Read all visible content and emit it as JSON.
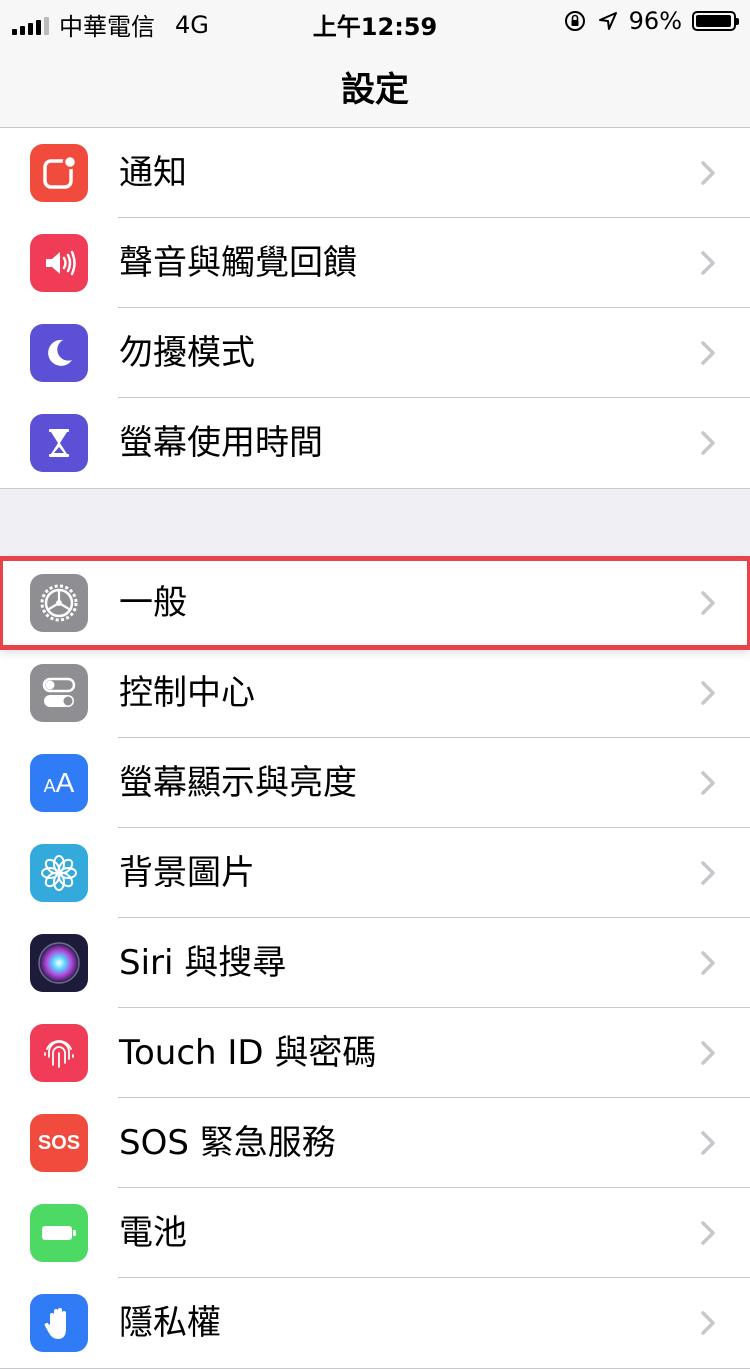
{
  "status_bar": {
    "carrier": "中華電信",
    "network": "4G",
    "time": "上午12:59",
    "battery_percent": "96%",
    "battery_level": 0.96
  },
  "nav": {
    "title": "設定"
  },
  "groups": [
    {
      "items": [
        {
          "label": "通知",
          "icon": "notifications-icon",
          "color": "#f04b3c"
        },
        {
          "label": "聲音與觸覺回饋",
          "icon": "speaker-icon",
          "color": "#f03c57"
        },
        {
          "label": "勿擾模式",
          "icon": "moon-icon",
          "color": "#5b50d6"
        },
        {
          "label": "螢幕使用時間",
          "icon": "hourglass-icon",
          "color": "#5b50d6"
        }
      ]
    },
    {
      "items": [
        {
          "label": "一般",
          "icon": "gear-icon",
          "color": "#8e8e93",
          "highlighted": true
        },
        {
          "label": "控制中心",
          "icon": "toggles-icon",
          "color": "#8e8e93"
        },
        {
          "label": "螢幕顯示與亮度",
          "icon": "text-size-icon",
          "color": "#2f7cf6",
          "icon_text": "AA"
        },
        {
          "label": "背景圖片",
          "icon": "flower-icon",
          "color": "#34aadc"
        },
        {
          "label": "Siri 與搜尋",
          "icon": "siri-icon",
          "color": "#1c1c3a"
        },
        {
          "label": "Touch ID 與密碼",
          "icon": "fingerprint-icon",
          "color": "#f03c57"
        },
        {
          "label": "SOS 緊急服務",
          "icon": "sos-icon",
          "color": "#f04b3c",
          "icon_text": "SOS"
        },
        {
          "label": "電池",
          "icon": "battery-icon",
          "color": "#4cd964"
        },
        {
          "label": "隱私權",
          "icon": "hand-icon",
          "color": "#2f7cf6"
        }
      ]
    }
  ]
}
